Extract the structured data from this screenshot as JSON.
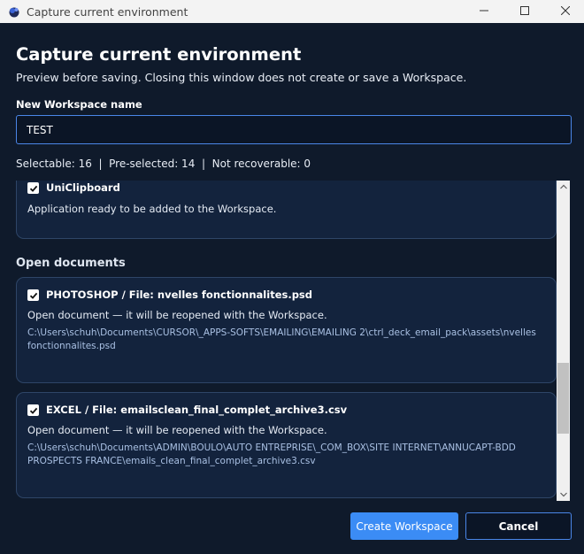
{
  "window": {
    "title": "Capture current environment",
    "controls": [
      "minimize-icon",
      "maximize-icon",
      "close-icon"
    ]
  },
  "header": {
    "title": "Capture current environment",
    "subtitle": "Preview before saving. Closing this window does not create or save a Workspace."
  },
  "workspace_name": {
    "label": "New Workspace name",
    "value": "TEST"
  },
  "stats": {
    "text": "Selectable: 16  |  Pre-selected: 14  |  Not recoverable: 0"
  },
  "application_card": {
    "title": "UniClipboard",
    "checked": true,
    "description": "Application ready to be added to the Workspace."
  },
  "open_documents": {
    "section_title": "Open documents",
    "items": [
      {
        "title": "PHOTOSHOP / File: nvelles fonctionnalites.psd",
        "checked": true,
        "description": "Open document — it will be reopened with the Workspace.",
        "path": "C:\\Users\\schuh\\Documents\\CURSOR\\_APPS-SOFTS\\EMAILING\\EMAILING 2\\ctrl_deck_email_pack\\assets\\nvelles fonctionnalites.psd"
      },
      {
        "title": "EXCEL / File: emailsclean_final_complet_archive3.csv",
        "checked": true,
        "description": "Open document — it will be reopened with the Workspace.",
        "path": "C:\\Users\\schuh\\Documents\\ADMIN\\BOULO\\AUTO ENTREPRISE\\_COM_BOX\\SITE INTERNET\\ANNUCAPT-BDD PROSPECTS FRANCE\\emails_clean_final_complet_archive3.csv"
      }
    ]
  },
  "buttons": {
    "create": "Create Workspace",
    "cancel": "Cancel"
  },
  "colors": {
    "background": "#0f1a2b",
    "card": "#13233d",
    "accent": "#3b8cf5",
    "input_border": "#4a86e8"
  }
}
